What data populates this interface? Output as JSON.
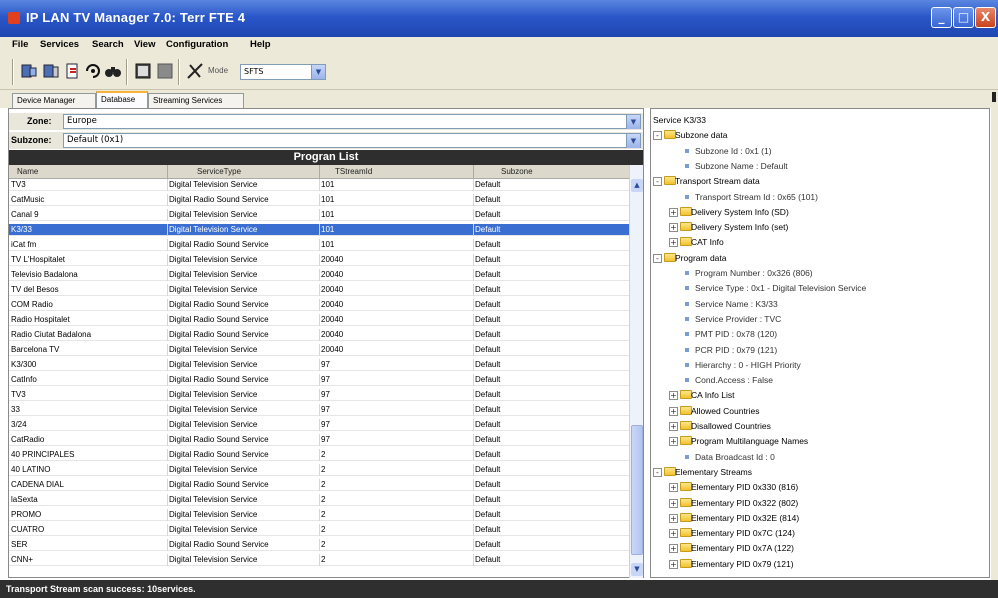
{
  "window": {
    "title": "IP LAN TV Manager 7.0: Terr FTE 4",
    "btn_min": "_",
    "btn_max": "□",
    "btn_close": "X"
  },
  "menu": [
    "File",
    "Services",
    "Search",
    "View",
    "Configuration",
    "Help"
  ],
  "toolbar": {
    "icons": [
      "connect-icon",
      "disconnect-icon",
      "refresh-icon",
      "scan-icon",
      "binoculars-icon",
      "stop-icon",
      "pause-icon",
      "tools-icon"
    ],
    "mode_label": "Mode",
    "mode_value": "SFTS",
    "combo_arrow": "▼"
  },
  "tabs": [
    "Device Manager",
    "Database",
    "Streaming Services"
  ],
  "active_tab": "Database",
  "zone": {
    "label": "Zone:",
    "value": "Europe",
    "arrow": "▼"
  },
  "subzone": {
    "label": "Subzone:",
    "value": "Default (0x1)",
    "arrow": "▼"
  },
  "program_list": {
    "title": "Progran List",
    "columns": [
      "Name",
      "ServiceType",
      "TStreamId",
      "Subzone"
    ],
    "rows": [
      [
        "TV3",
        "Digital Television Service",
        "101",
        "Default"
      ],
      [
        "CatMusic",
        "Digital Radio Sound Service",
        "101",
        "Default"
      ],
      [
        "Canal 9",
        "Digital Television Service",
        "101",
        "Default"
      ],
      [
        "K3/33",
        "Digital Television Service",
        "101",
        "Default"
      ],
      [
        "iCat fm",
        "Digital Radio Sound Service",
        "101",
        "Default"
      ],
      [
        "TV L'Hospitalet",
        "Digital Television Service",
        "20040",
        "Default"
      ],
      [
        "Televisio Badalona",
        "Digital Television Service",
        "20040",
        "Default"
      ],
      [
        "TV del Besos",
        "Digital Television Service",
        "20040",
        "Default"
      ],
      [
        "COM Radio",
        "Digital Radio Sound Service",
        "20040",
        "Default"
      ],
      [
        "Radio Hospitalet",
        "Digital Radio Sound Service",
        "20040",
        "Default"
      ],
      [
        "Radio Ciutat Badalona",
        "Digital Radio Sound Service",
        "20040",
        "Default"
      ],
      [
        "Barcelona TV",
        "Digital Television Service",
        "20040",
        "Default"
      ],
      [
        "K3/300",
        "Digital Television Service",
        "97",
        "Default"
      ],
      [
        "CatInfo",
        "Digital Radio Sound Service",
        "97",
        "Default"
      ],
      [
        "TV3",
        "Digital Television Service",
        "97",
        "Default"
      ],
      [
        "33",
        "Digital Television Service",
        "97",
        "Default"
      ],
      [
        "3/24",
        "Digital Television Service",
        "97",
        "Default"
      ],
      [
        "CatRadio",
        "Digital Radio Sound Service",
        "97",
        "Default"
      ],
      [
        "40 PRINCIPALES",
        "Digital Radio Sound Service",
        "2",
        "Default"
      ],
      [
        "40 LATINO",
        "Digital Television Service",
        "2",
        "Default"
      ],
      [
        "CADENA DIAL",
        "Digital Radio Sound Service",
        "2",
        "Default"
      ],
      [
        "laSexta",
        "Digital Television Service",
        "2",
        "Default"
      ],
      [
        "PROMO",
        "Digital Television Service",
        "2",
        "Default"
      ],
      [
        "CUATRO",
        "Digital Television Service",
        "2",
        "Default"
      ],
      [
        "SER",
        "Digital Radio Sound Service",
        "2",
        "Default"
      ],
      [
        "CNN+",
        "Digital Television Service",
        "2",
        "Default"
      ]
    ],
    "selected_index": 3,
    "scroll_up": "▲",
    "scroll_down": "▼"
  },
  "tree": [
    {
      "text": "Service K3/33",
      "kind": "root",
      "depth": 0
    },
    {
      "text": "Subzone data",
      "kind": "folder",
      "expander": "-",
      "depth": 0
    },
    {
      "text": "Subzone Id : 0x1 (1)",
      "kind": "leaf",
      "depth": 2
    },
    {
      "text": "Subzone Name : Default",
      "kind": "leaf",
      "depth": 2
    },
    {
      "text": "Transport Stream data",
      "kind": "folder",
      "expander": "-",
      "depth": 0
    },
    {
      "text": "Transport Stream Id : 0x65 (101)",
      "kind": "leaf",
      "depth": 2
    },
    {
      "text": "Delivery System Info (SD)",
      "kind": "folder",
      "expander": "+",
      "depth": 1
    },
    {
      "text": "Delivery System Info (set)",
      "kind": "folder",
      "expander": "+",
      "depth": 1
    },
    {
      "text": "CAT Info",
      "kind": "folder",
      "expander": "+",
      "depth": 1
    },
    {
      "text": "Program data",
      "kind": "folder",
      "expander": "-",
      "depth": 0
    },
    {
      "text": "Program Number : 0x326 (806)",
      "kind": "leaf",
      "depth": 2
    },
    {
      "text": "Service Type : 0x1 - Digital Television Service",
      "kind": "leaf",
      "depth": 2
    },
    {
      "text": "Service Name : K3/33",
      "kind": "leaf",
      "depth": 2
    },
    {
      "text": "Service Provider : TVC",
      "kind": "leaf",
      "depth": 2
    },
    {
      "text": "PMT PID : 0x78 (120)",
      "kind": "leaf",
      "depth": 2
    },
    {
      "text": "PCR PID : 0x79 (121)",
      "kind": "leaf",
      "depth": 2
    },
    {
      "text": "Hierarchy : 0 - HIGH Priority",
      "kind": "leaf",
      "depth": 2
    },
    {
      "text": "Cond.Access : False",
      "kind": "leaf",
      "depth": 2
    },
    {
      "text": "CA Info List",
      "kind": "folder",
      "expander": "+",
      "depth": 1
    },
    {
      "text": "Allowed Countries",
      "kind": "folder",
      "expander": "+",
      "depth": 1
    },
    {
      "text": "Disallowed Countries",
      "kind": "folder",
      "expander": "+",
      "depth": 1
    },
    {
      "text": "Program Multilanguage Names",
      "kind": "folder",
      "expander": "+",
      "depth": 1
    },
    {
      "text": "Data Broadcast Id : 0",
      "kind": "leaf",
      "depth": 2
    },
    {
      "text": "Elementary Streams",
      "kind": "folder",
      "expander": "-",
      "depth": 0
    },
    {
      "text": "Elementary PID 0x330 (816)",
      "kind": "folder",
      "expander": "+",
      "depth": 1
    },
    {
      "text": "Elementary PID 0x322 (802)",
      "kind": "folder",
      "expander": "+",
      "depth": 1
    },
    {
      "text": "Elementary PID 0x32E (814)",
      "kind": "folder",
      "expander": "+",
      "depth": 1
    },
    {
      "text": "Elementary PID 0x7C (124)",
      "kind": "folder",
      "expander": "+",
      "depth": 1
    },
    {
      "text": "Elementary PID 0x7A (122)",
      "kind": "folder",
      "expander": "+",
      "depth": 1
    },
    {
      "text": "Elementary PID 0x79 (121)",
      "kind": "folder",
      "expander": "+",
      "depth": 1
    }
  ],
  "status": "Transport Stream scan success: 10services.",
  "colors": {
    "title_bar": "#2a57c8",
    "selection": "#3a6fd1",
    "list_header": "#2e2e2e",
    "status_bar": "#2f2f2f",
    "folder": "#f2c330"
  }
}
